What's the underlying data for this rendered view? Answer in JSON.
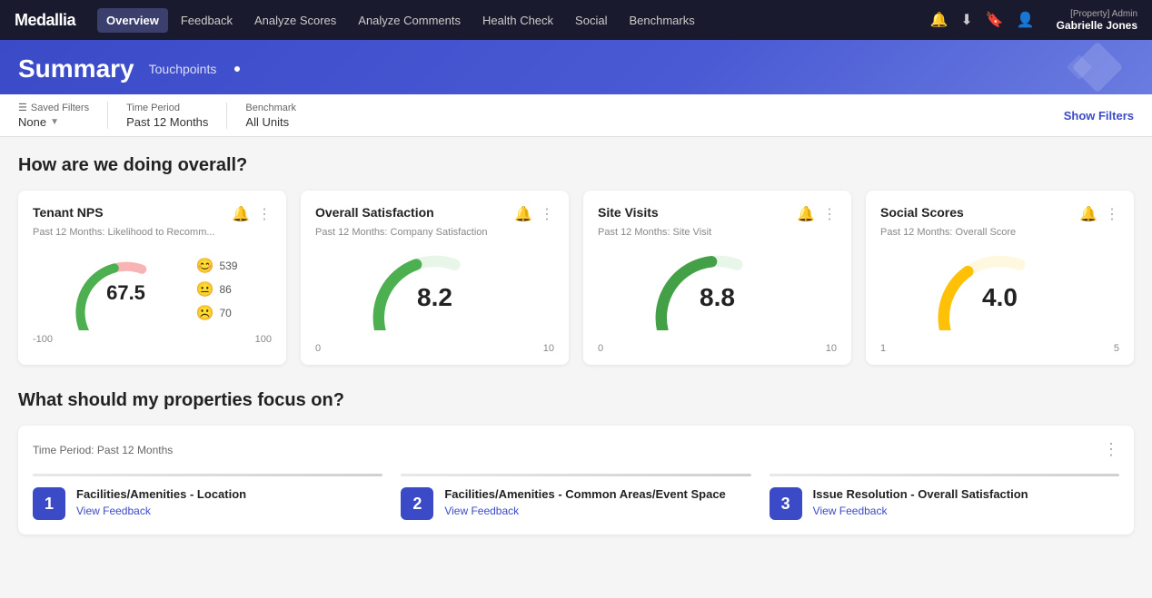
{
  "brand": "Medallia",
  "nav": {
    "links": [
      {
        "label": "Overview",
        "active": true
      },
      {
        "label": "Feedback",
        "active": false
      },
      {
        "label": "Analyze Scores",
        "active": false
      },
      {
        "label": "Analyze Comments",
        "active": false
      },
      {
        "label": "Health Check",
        "active": false
      },
      {
        "label": "Social",
        "active": false
      },
      {
        "label": "Benchmarks",
        "active": false
      }
    ],
    "user_role": "[Property] Admin",
    "user_name": "Gabrielle Jones"
  },
  "header": {
    "title": "Summary",
    "subtitle": "Touchpoints"
  },
  "filters": {
    "saved_filters_label": "Saved Filters",
    "saved_filters_value": "None",
    "time_period_label": "Time Period",
    "time_period_value": "Past 12 Months",
    "benchmark_label": "Benchmark",
    "benchmark_value": "All Units",
    "show_filters": "Show Filters"
  },
  "overall_section": {
    "title": "How are we doing overall?"
  },
  "cards": [
    {
      "id": "tenant-nps",
      "title": "Tenant NPS",
      "subtitle": "Past 12 Months: Likelihood to Recomm...",
      "value": "67.5",
      "gauge_min": "-100",
      "gauge_max": "100",
      "gauge_color": "#4caf50",
      "gauge_bg": "#f8b4b4",
      "gauge_percent": 84,
      "nps": true,
      "stats": [
        {
          "emoji": "😊",
          "count": "539"
        },
        {
          "emoji": "😐",
          "count": "86"
        },
        {
          "emoji": "☹️",
          "count": "70"
        }
      ]
    },
    {
      "id": "overall-satisfaction",
      "title": "Overall Satisfaction",
      "subtitle": "Past 12 Months: Company Satisfaction",
      "value": "8.2",
      "gauge_min": "0",
      "gauge_max": "10",
      "gauge_color": "#4caf50",
      "gauge_bg": "#e8f5e9",
      "gauge_percent": 82,
      "nps": false
    },
    {
      "id": "site-visits",
      "title": "Site Visits",
      "subtitle": "Past 12 Months: Site Visit",
      "value": "8.8",
      "gauge_min": "0",
      "gauge_max": "10",
      "gauge_color": "#43a047",
      "gauge_bg": "#e8f5e9",
      "gauge_percent": 88,
      "nps": false
    },
    {
      "id": "social-scores",
      "title": "Social Scores",
      "subtitle": "Past 12 Months: Overall Score",
      "value": "4.0",
      "gauge_min": "1",
      "gauge_max": "5",
      "gauge_color": "#ffc107",
      "gauge_bg": "#fff8e1",
      "gauge_percent": 75,
      "nps": false
    }
  ],
  "focus_section": {
    "title": "What should my properties focus on?",
    "time_period": "Time Period: Past 12 Months",
    "items": [
      {
        "number": "1",
        "name": "Facilities/Amenities - Location",
        "link": "View Feedback"
      },
      {
        "number": "2",
        "name": "Facilities/Amenities - Common Areas/Event Space",
        "link": "View Feedback"
      },
      {
        "number": "3",
        "name": "Issue Resolution - Overall Satisfaction",
        "link": "View Feedback"
      }
    ]
  }
}
